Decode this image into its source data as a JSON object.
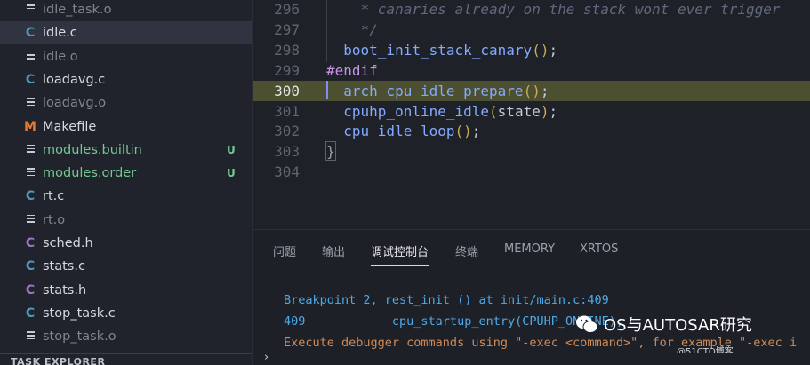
{
  "sidebar": {
    "files": [
      {
        "name": "idle_task.o",
        "type": "o",
        "dim": true,
        "badge": ""
      },
      {
        "name": "idle.c",
        "type": "c",
        "dim": false,
        "active": true,
        "badge": ""
      },
      {
        "name": "idle.o",
        "type": "o",
        "dim": true,
        "badge": ""
      },
      {
        "name": "loadavg.c",
        "type": "c",
        "dim": false,
        "badge": ""
      },
      {
        "name": "loadavg.o",
        "type": "o",
        "dim": true,
        "badge": ""
      },
      {
        "name": "Makefile",
        "type": "m",
        "dim": false,
        "badge": ""
      },
      {
        "name": "modules.builtin",
        "type": "o",
        "dim": false,
        "green": true,
        "badge": "U"
      },
      {
        "name": "modules.order",
        "type": "o",
        "dim": false,
        "green": true,
        "badge": "U"
      },
      {
        "name": "rt.c",
        "type": "c",
        "dim": false,
        "badge": ""
      },
      {
        "name": "rt.o",
        "type": "o",
        "dim": true,
        "badge": ""
      },
      {
        "name": "sched.h",
        "type": "h",
        "dim": false,
        "badge": ""
      },
      {
        "name": "stats.c",
        "type": "c",
        "dim": false,
        "badge": ""
      },
      {
        "name": "stats.h",
        "type": "h",
        "dim": false,
        "badge": ""
      },
      {
        "name": "stop_task.c",
        "type": "c",
        "dim": false,
        "badge": ""
      },
      {
        "name": "stop_task.o",
        "type": "o",
        "dim": true,
        "badge": ""
      }
    ],
    "section_title": "TASK EXPLORER"
  },
  "editor": {
    "lines": [
      {
        "num": "296",
        "text": "    * canaries already on the stack wont ever trigger",
        "kind": "comment"
      },
      {
        "num": "297",
        "text": "    */",
        "kind": "comment"
      },
      {
        "num": "298",
        "fn": "boot_init_stack_canary",
        "args": "",
        "indent": "  ",
        "kind": "call"
      },
      {
        "num": "299",
        "text": "#endif",
        "kind": "pre"
      },
      {
        "num": "300",
        "fn": "arch_cpu_idle_prepare",
        "args": "",
        "indent": "  ",
        "kind": "call",
        "current": true
      },
      {
        "num": "301",
        "fn": "cpuhp_online_idle",
        "args": "state",
        "indent": "  ",
        "kind": "call"
      },
      {
        "num": "302",
        "fn": "cpu_idle_loop",
        "args": "",
        "indent": "  ",
        "kind": "call"
      },
      {
        "num": "303",
        "text": "}",
        "kind": "brace"
      },
      {
        "num": "304",
        "text": "",
        "kind": "empty"
      }
    ]
  },
  "panel": {
    "tabs": [
      "问题",
      "输出",
      "调试控制台",
      "终端",
      "MEMORY",
      "XRTOS"
    ],
    "active_tab": 2,
    "output": [
      {
        "text": "Breakpoint 2, rest_init () at init/main.c:409",
        "color": "blue"
      },
      {
        "text": "409            cpu_startup_entry(CPUHP_ONLINE);",
        "color": "blue"
      },
      {
        "text": "Execute debugger commands using \"-exec <command>\", for example \"-exec i",
        "color": "orange"
      }
    ],
    "watermark": "OS与AUTOSAR研究",
    "watermark_url": "@51CTO博客"
  },
  "bottom": {
    "chevron": "›"
  }
}
